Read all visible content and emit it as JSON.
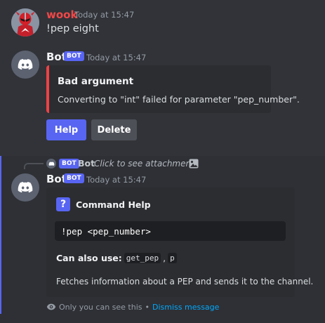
{
  "colors": {
    "background": "#313338",
    "embed_bg": "#2b2d31",
    "username_user": "#f04747",
    "bot_badge": "#5865f2",
    "error_accent": "#ed4245",
    "link": "#00a8fc"
  },
  "message1": {
    "username": "wook",
    "timestamp": "Today at 15:47",
    "text": "!pep eight",
    "avatar_icon": "red-ranger-avatar"
  },
  "message2": {
    "username": "Bot",
    "badge": "BOT",
    "timestamp": "Today at 15:47",
    "avatar_icon": "discord-logo-icon",
    "embed": {
      "title": "Bad argument",
      "description": "Converting to \"int\" failed for parameter \"pep_number\"."
    },
    "buttons": {
      "help": "Help",
      "delete": "Delete"
    }
  },
  "reply_preview": {
    "badge": "BOT",
    "username": "Bot",
    "text": "Click to see attachment",
    "attachment_icon": "image-icon"
  },
  "message3": {
    "username": "Bot",
    "badge": "BOT",
    "timestamp": "Today at 15:47",
    "avatar_icon": "discord-logo-icon",
    "embed": {
      "title_icon": "question-mark-icon",
      "title": "Command Help",
      "code": "!pep <pep_number>",
      "also_label": "Can also use:",
      "aliases": [
        "get_pep",
        "p"
      ],
      "alias_separator": ",",
      "description": "Fetches information about a PEP and sends it to the channel."
    },
    "ephemeral": {
      "icon": "eye-icon",
      "text": "Only you can see this",
      "separator": "•",
      "dismiss": "Dismiss message"
    }
  }
}
